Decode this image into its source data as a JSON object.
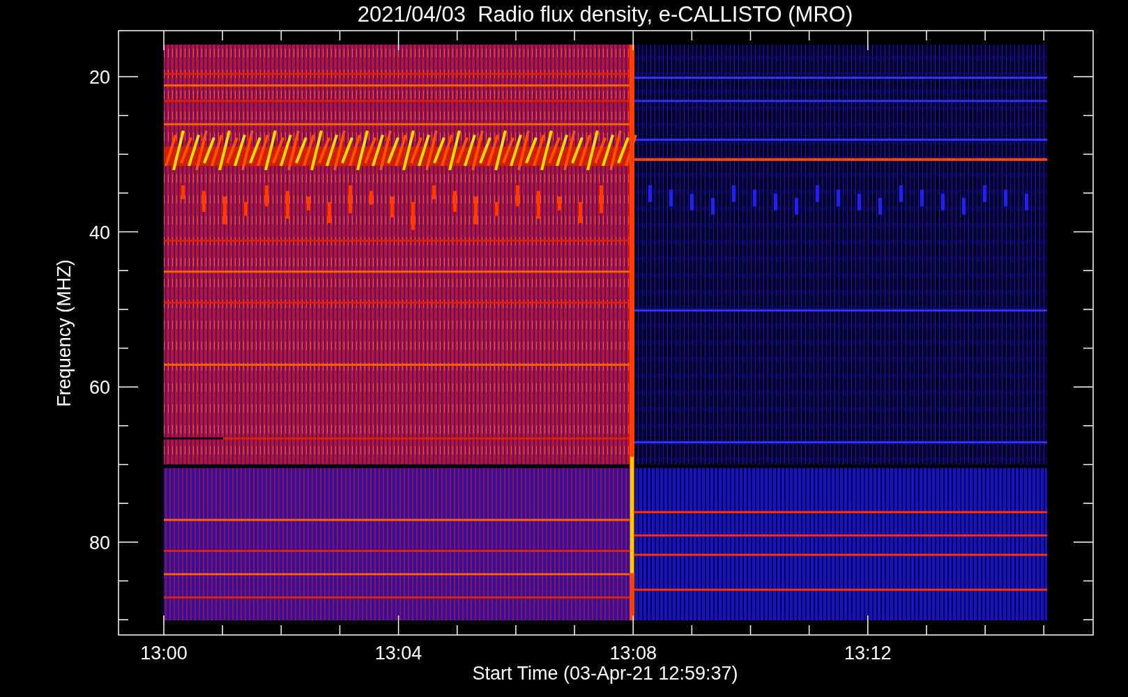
{
  "title": "2021/04/03  Radio flux density, e-CALLISTO (MRO)",
  "y_axis": {
    "label": "Frequency (MHZ)",
    "ticks": [
      "20",
      "40",
      "60",
      "80"
    ]
  },
  "x_axis": {
    "label": "Start Time (03-Apr-21 12:59:37)",
    "ticks": [
      "13:00",
      "13:04",
      "13:08",
      "13:12"
    ]
  }
}
